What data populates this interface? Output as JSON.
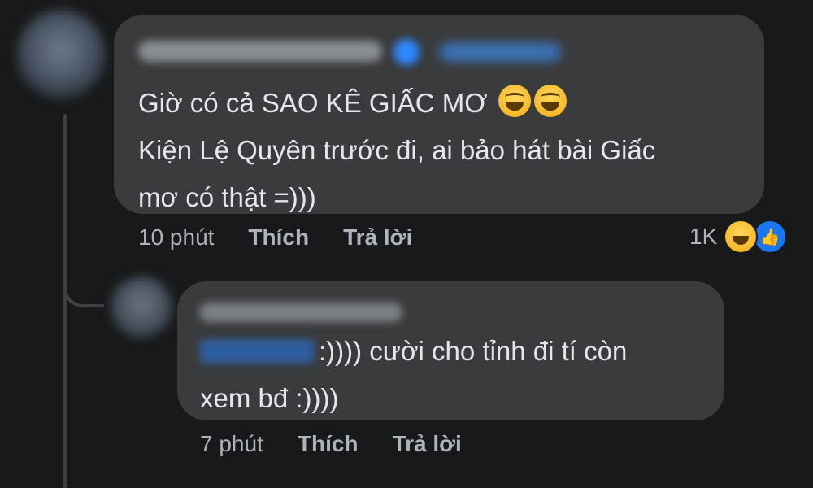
{
  "comments": [
    {
      "text_lines": [
        "Giờ có cả SAO KÊ GIẤC MƠ",
        "Kiện Lệ Quyên trước đi, ai bảo hát bài Giấc",
        "mơ có thật =)))"
      ],
      "emojis": [
        "laughing-squint-icon",
        "laughing-squint-icon"
      ],
      "time": "10 phút",
      "like_label": "Thích",
      "reply_label": "Trả lời",
      "reaction_count": "1K",
      "reaction_icons": [
        "haha-icon",
        "like-icon"
      ]
    },
    {
      "text_after_mention": ":)))) cười cho tỉnh đi tí còn",
      "text_line_2": "xem bđ :))))",
      "time": "7 phút",
      "like_label": "Thích",
      "reply_label": "Trả lời"
    }
  ],
  "colors": {
    "background": "#18191a",
    "bubble": "#3a3b3c",
    "text": "#e4e6eb",
    "muted": "#b0b3b8",
    "like_blue": "#1877f2"
  }
}
